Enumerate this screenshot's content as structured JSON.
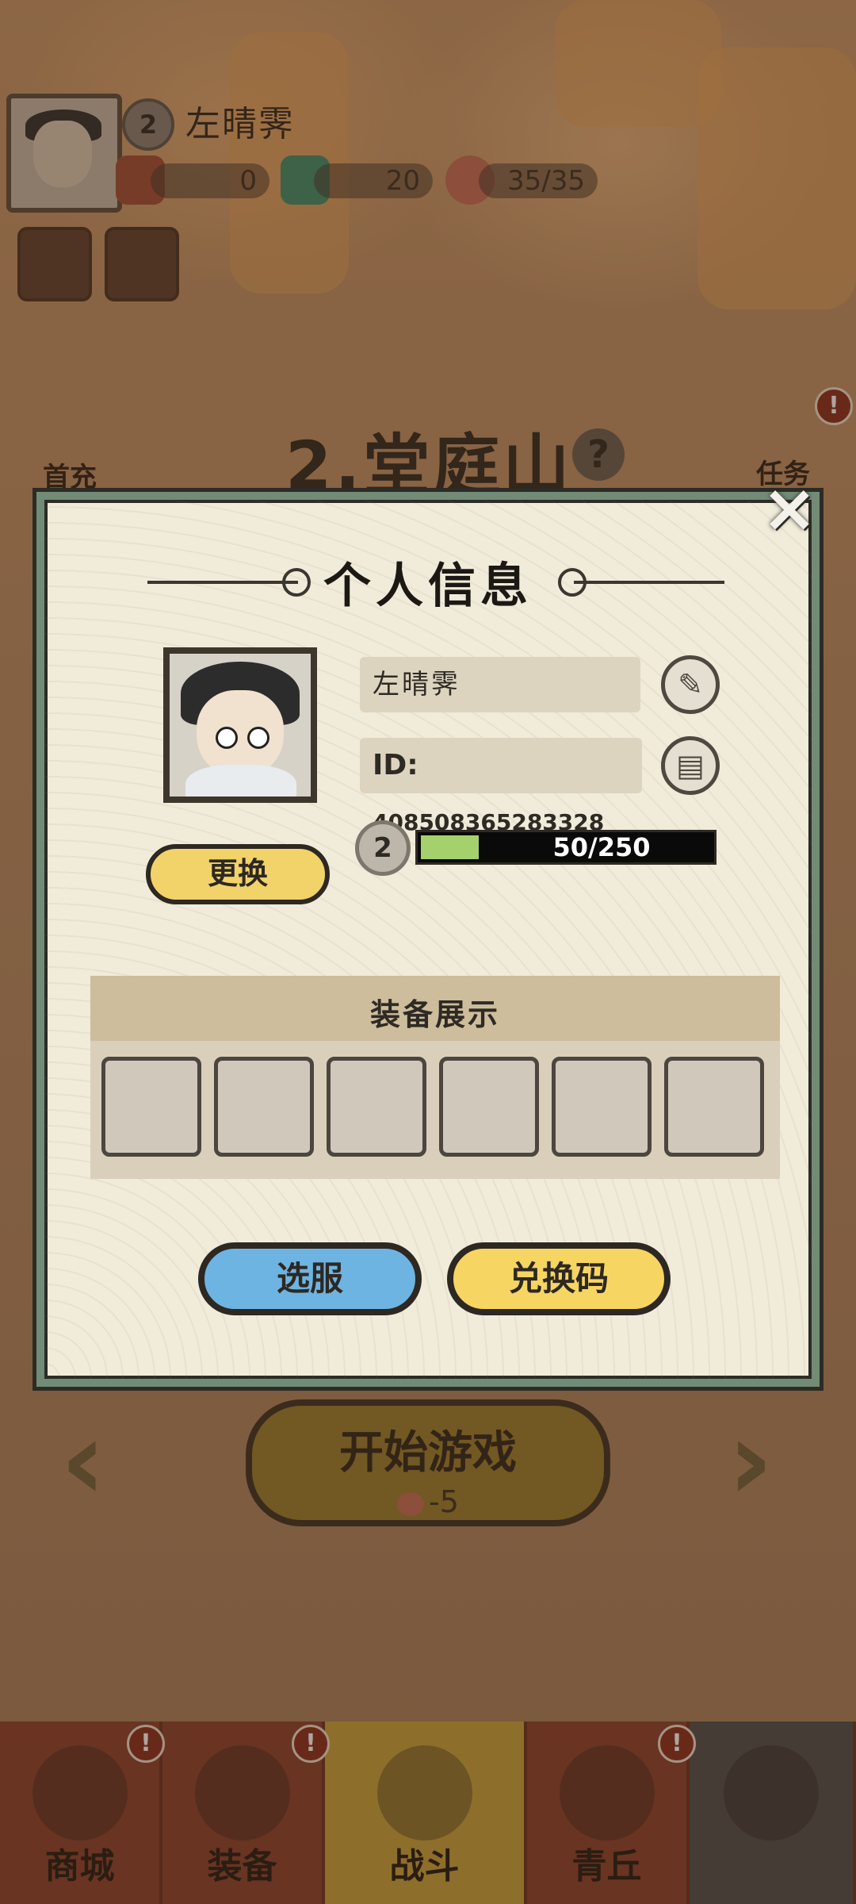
{
  "hud": {
    "level": "2",
    "player_name": "左晴霁",
    "currency_a": "0",
    "currency_b": "20",
    "stamina": "35/35"
  },
  "side": {
    "first_charge_label": "首充",
    "task_label": "任务",
    "badge": "!"
  },
  "stage": {
    "title": "2.堂庭山",
    "help_icon": "?"
  },
  "start": {
    "label": "开始游戏",
    "cost": "-5",
    "cost_icon": "peach-icon"
  },
  "tabs": [
    {
      "label": "商城",
      "badge": "!"
    },
    {
      "label": "装备",
      "badge": "!"
    },
    {
      "label": "战斗",
      "badge": ""
    },
    {
      "label": "青丘",
      "badge": "!"
    },
    {
      "label": "",
      "badge": ""
    }
  ],
  "modal": {
    "title": "个人信息",
    "close_icon": "×",
    "name": "左晴霁",
    "id_label": "ID:",
    "id_value": "408508365283328",
    "level": "2",
    "xp_text": "50/250",
    "xp_current": 50,
    "xp_max": 250,
    "swap_label": "更换",
    "equip_title": "装备展示",
    "equip_slots": 6,
    "server_button": "选服",
    "redeem_button": "兑换码"
  },
  "colors": {
    "accent_yellow": "#f7d562",
    "accent_blue": "#6db4e2",
    "modal_border": "#728b76",
    "xp_fill": "#a5d16c"
  }
}
